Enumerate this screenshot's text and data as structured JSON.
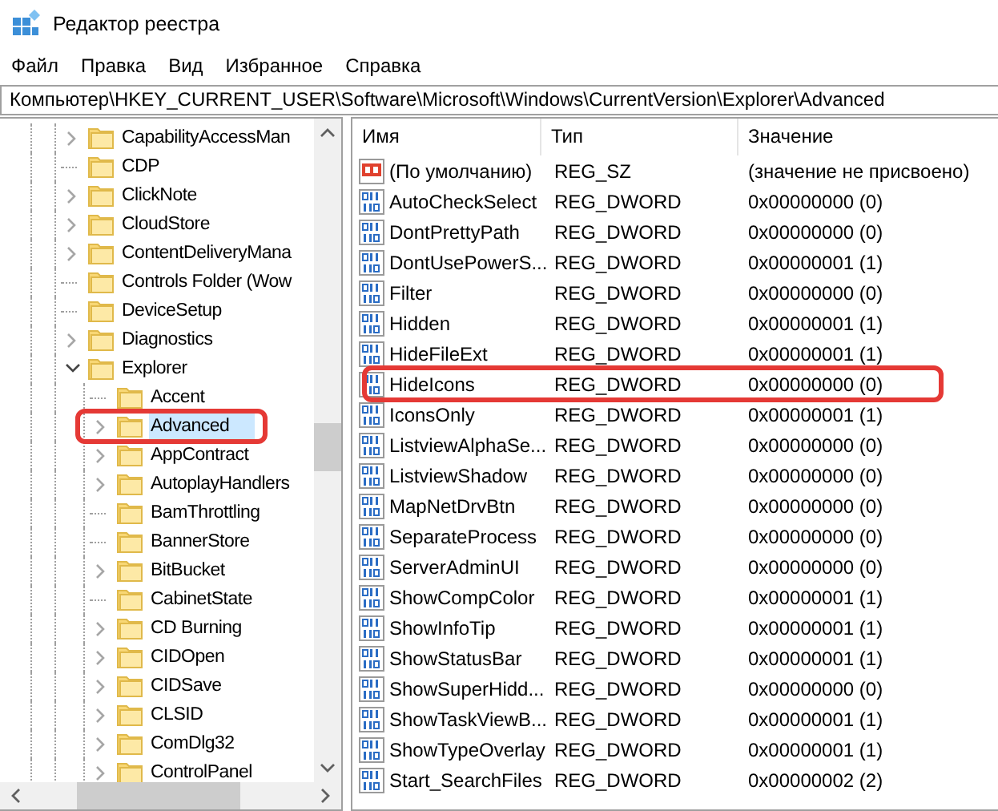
{
  "window": {
    "title": "Редактор реестра"
  },
  "menu": [
    "Файл",
    "Правка",
    "Вид",
    "Избранное",
    "Справка"
  ],
  "address": "Компьютер\\HKEY_CURRENT_USER\\Software\\Microsoft\\Windows\\CurrentVersion\\Explorer\\Advanced",
  "tree": {
    "items": [
      {
        "label": "CapabilityAccessMan",
        "expandable": true,
        "expanded": false,
        "selected": false
      },
      {
        "label": "CDP",
        "expandable": false,
        "expanded": false,
        "selected": false
      },
      {
        "label": "ClickNote",
        "expandable": true,
        "expanded": false,
        "selected": false
      },
      {
        "label": "CloudStore",
        "expandable": true,
        "expanded": false,
        "selected": false
      },
      {
        "label": "ContentDeliveryMana",
        "expandable": true,
        "expanded": false,
        "selected": false
      },
      {
        "label": "Controls Folder (Wow",
        "expandable": false,
        "expanded": false,
        "selected": false
      },
      {
        "label": "DeviceSetup",
        "expandable": false,
        "expanded": false,
        "selected": false
      },
      {
        "label": "Diagnostics",
        "expandable": true,
        "expanded": false,
        "selected": false
      },
      {
        "label": "Explorer",
        "expandable": true,
        "expanded": true,
        "selected": false,
        "children": [
          {
            "label": "Accent",
            "expandable": false,
            "expanded": false,
            "selected": false
          },
          {
            "label": "Advanced",
            "expandable": true,
            "expanded": false,
            "selected": true,
            "highlighted": true
          },
          {
            "label": "AppContract",
            "expandable": true,
            "expanded": false,
            "selected": false
          },
          {
            "label": "AutoplayHandlers",
            "expandable": true,
            "expanded": false,
            "selected": false
          },
          {
            "label": "BamThrottling",
            "expandable": false,
            "expanded": false,
            "selected": false
          },
          {
            "label": "BannerStore",
            "expandable": false,
            "expanded": false,
            "selected": false
          },
          {
            "label": "BitBucket",
            "expandable": true,
            "expanded": false,
            "selected": false
          },
          {
            "label": "CabinetState",
            "expandable": false,
            "expanded": false,
            "selected": false
          },
          {
            "label": "CD Burning",
            "expandable": true,
            "expanded": false,
            "selected": false
          },
          {
            "label": "CIDOpen",
            "expandable": true,
            "expanded": false,
            "selected": false
          },
          {
            "label": "CIDSave",
            "expandable": true,
            "expanded": false,
            "selected": false
          },
          {
            "label": "CLSID",
            "expandable": true,
            "expanded": false,
            "selected": false
          },
          {
            "label": "ComDlg32",
            "expandable": true,
            "expanded": false,
            "selected": false
          },
          {
            "label": "ControlPanel",
            "expandable": true,
            "expanded": false,
            "selected": false
          }
        ]
      }
    ]
  },
  "values": {
    "columns": [
      "Имя",
      "Тип",
      "Значение"
    ],
    "rows": [
      {
        "kind": "string",
        "name": "(По умолчанию)",
        "type": "REG_SZ",
        "data": "(значение не присвоено)"
      },
      {
        "kind": "dword",
        "name": "AutoCheckSelect",
        "type": "REG_DWORD",
        "data": "0x00000000 (0)"
      },
      {
        "kind": "dword",
        "name": "DontPrettyPath",
        "type": "REG_DWORD",
        "data": "0x00000000 (0)"
      },
      {
        "kind": "dword",
        "name": "DontUsePowerS...",
        "type": "REG_DWORD",
        "data": "0x00000001 (1)"
      },
      {
        "kind": "dword",
        "name": "Filter",
        "type": "REG_DWORD",
        "data": "0x00000000 (0)"
      },
      {
        "kind": "dword",
        "name": "Hidden",
        "type": "REG_DWORD",
        "data": "0x00000001 (1)"
      },
      {
        "kind": "dword",
        "name": "HideFileExt",
        "type": "REG_DWORD",
        "data": "0x00000001 (1)"
      },
      {
        "kind": "dword",
        "name": "HideIcons",
        "type": "REG_DWORD",
        "data": "0x00000000 (0)",
        "highlighted": true
      },
      {
        "kind": "dword",
        "name": "IconsOnly",
        "type": "REG_DWORD",
        "data": "0x00000001 (1)"
      },
      {
        "kind": "dword",
        "name": "ListviewAlphaSe...",
        "type": "REG_DWORD",
        "data": "0x00000000 (0)"
      },
      {
        "kind": "dword",
        "name": "ListviewShadow",
        "type": "REG_DWORD",
        "data": "0x00000000 (0)"
      },
      {
        "kind": "dword",
        "name": "MapNetDrvBtn",
        "type": "REG_DWORD",
        "data": "0x00000000 (0)"
      },
      {
        "kind": "dword",
        "name": "SeparateProcess",
        "type": "REG_DWORD",
        "data": "0x00000000 (0)"
      },
      {
        "kind": "dword",
        "name": "ServerAdminUI",
        "type": "REG_DWORD",
        "data": "0x00000000 (0)"
      },
      {
        "kind": "dword",
        "name": "ShowCompColor",
        "type": "REG_DWORD",
        "data": "0x00000001 (1)"
      },
      {
        "kind": "dword",
        "name": "ShowInfoTip",
        "type": "REG_DWORD",
        "data": "0x00000001 (1)"
      },
      {
        "kind": "dword",
        "name": "ShowStatusBar",
        "type": "REG_DWORD",
        "data": "0x00000001 (1)"
      },
      {
        "kind": "dword",
        "name": "ShowSuperHidd...",
        "type": "REG_DWORD",
        "data": "0x00000000 (0)"
      },
      {
        "kind": "dword",
        "name": "ShowTaskViewB...",
        "type": "REG_DWORD",
        "data": "0x00000001 (1)"
      },
      {
        "kind": "dword",
        "name": "ShowTypeOverlay",
        "type": "REG_DWORD",
        "data": "0x00000001 (1)"
      },
      {
        "kind": "dword",
        "name": "Start_SearchFiles",
        "type": "REG_DWORD",
        "data": "0x00000002 (2)"
      }
    ]
  }
}
